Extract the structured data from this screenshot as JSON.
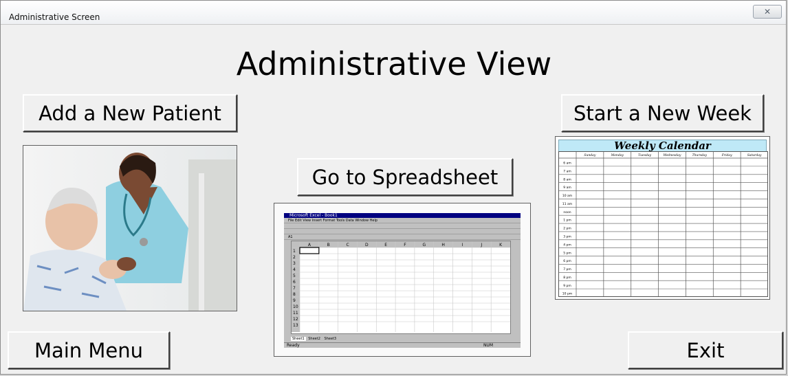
{
  "window": {
    "title": "Administrative Screen",
    "close_glyph": "✕"
  },
  "page": {
    "title": "Administrative View"
  },
  "buttons": {
    "add_patient": "Add a New Patient",
    "start_week": "Start a New Week",
    "go_spreadsheet": "Go to Spreadsheet",
    "main_menu": "Main Menu",
    "exit": "Exit"
  },
  "images": {
    "patient_photo": "nurse-with-patient-photo",
    "spreadsheet_preview": "excel-spreadsheet-screenshot",
    "calendar_preview": "weekly-calendar-grid"
  },
  "excel_preview": {
    "title": "Microsoft Excel - Book1",
    "menu": [
      "File",
      "Edit",
      "View",
      "Insert",
      "Format",
      "Tools",
      "Data",
      "Window",
      "Help"
    ],
    "cell_ref": "A1",
    "columns": [
      "A",
      "B",
      "C",
      "D",
      "E",
      "F",
      "G",
      "H",
      "I",
      "J",
      "K"
    ],
    "rows": [
      "1",
      "2",
      "3",
      "4",
      "5",
      "6",
      "7",
      "8",
      "9",
      "10",
      "11",
      "12",
      "13"
    ],
    "sheet_tabs": [
      "Sheet1",
      "Sheet2",
      "Sheet3"
    ],
    "status": "Ready",
    "num_indicator": "NUM"
  },
  "calendar_preview": {
    "title": "Weekly Calendar",
    "days": [
      "Sunday",
      "Monday",
      "Tuesday",
      "Wednesday",
      "Thursday",
      "Friday",
      "Saturday"
    ],
    "times": [
      "6 am",
      "7 am",
      "8 am",
      "9 am",
      "10 am",
      "11 am",
      "noon",
      "1 pm",
      "2 pm",
      "3 pm",
      "4 pm",
      "5 pm",
      "6 pm",
      "7 pm",
      "8 pm",
      "9 pm",
      "10 pm"
    ]
  }
}
